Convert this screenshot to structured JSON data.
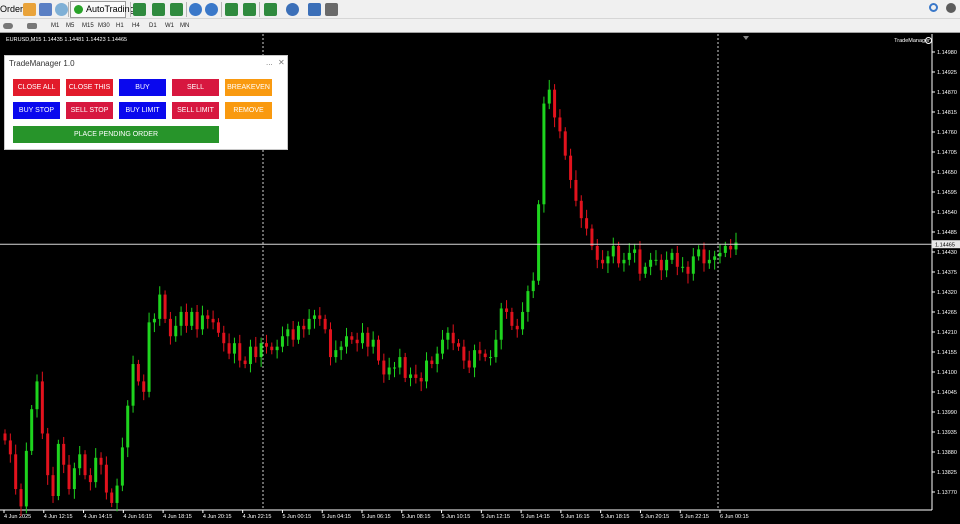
{
  "toolbar": {
    "order_label": "Order",
    "autotrading_label": "AutoTrading",
    "timeframes": [
      "M1",
      "M5",
      "M15",
      "M30",
      "H1",
      "H4",
      "D1",
      "W1",
      "MN"
    ]
  },
  "chart": {
    "symbol_info": "EURUSD,M15  1.14435 1.14481 1.14423 1.14465",
    "ea_name": "TradeManager",
    "current_price": "1.14465",
    "price_ticks": [
      "1.14980",
      "1.14925",
      "1.14870",
      "1.14815",
      "1.14760",
      "1.14705",
      "1.14650",
      "1.14595",
      "1.14540",
      "1.14485",
      "1.14430",
      "1.14375",
      "1.14320",
      "1.14265",
      "1.14210",
      "1.14155",
      "1.14100",
      "1.14045",
      "1.13990",
      "1.13935",
      "1.13880",
      "1.13825",
      "1.13770"
    ],
    "time_ticks": [
      "4 Jun 2025",
      "4 Jun 12:15",
      "4 Jun 14:15",
      "4 Jun 16:15",
      "4 Jun 18:15",
      "4 Jun 20:15",
      "4 Jun 22:15",
      "5 Jun 00:15",
      "5 Jun 04:15",
      "5 Jun 06:15",
      "5 Jun 08:15",
      "5 Jun 10:15",
      "5 Jun 12:15",
      "5 Jun 14:15",
      "5 Jun 16:15",
      "5 Jun 18:15",
      "5 Jun 20:15",
      "5 Jun 22:15",
      "6 Jun 00:15"
    ],
    "colors": {
      "bull": "#1ed41e",
      "bear": "#e2121d",
      "axis": "#ffffff"
    }
  },
  "chart_data": {
    "type": "candlestick",
    "symbol": "EURUSD",
    "timeframe": "M15",
    "ylim": [
      1.1374,
      1.1503
    ],
    "closes": [
      1.139,
      1.1386,
      1.1376,
      1.1371,
      1.1387,
      1.1399,
      1.1407,
      1.1392,
      1.138,
      1.1374,
      1.1389,
      1.1383,
      1.1376,
      1.1382,
      1.1386,
      1.138,
      1.1378,
      1.1385,
      1.1383,
      1.1375,
      1.1372,
      1.1377,
      1.1388,
      1.14,
      1.1412,
      1.1407,
      1.1404,
      1.1424,
      1.1425,
      1.1432,
      1.1425,
      1.142,
      1.1423,
      1.1427,
      1.1423,
      1.1427,
      1.1422,
      1.1426,
      1.1425,
      1.1424,
      1.1421,
      1.1418,
      1.1415,
      1.1418,
      1.1413,
      1.1412,
      1.1417,
      1.1414,
      1.1418,
      1.1417,
      1.1416,
      1.1417,
      1.142,
      1.1422,
      1.1419,
      1.1423,
      1.1422,
      1.1425,
      1.1426,
      1.1425,
      1.1422,
      1.1414,
      1.1416,
      1.1417,
      1.142,
      1.1419,
      1.1418,
      1.1421,
      1.1417,
      1.1419,
      1.1413,
      1.1409,
      1.1411,
      1.1411,
      1.1414,
      1.1408,
      1.1409,
      1.1408,
      1.1407,
      1.1413,
      1.1412,
      1.1415,
      1.1419,
      1.1421,
      1.1418,
      1.1417,
      1.1413,
      1.1411,
      1.1416,
      1.1415,
      1.1414,
      1.1414,
      1.1419,
      1.1428,
      1.1427,
      1.1423,
      1.1422,
      1.1427,
      1.1433,
      1.1436,
      1.1458,
      1.1487,
      1.1491,
      1.1483,
      1.1479,
      1.1472,
      1.1465,
      1.1459,
      1.1454,
      1.1451,
      1.1446,
      1.1442,
      1.1441,
      1.1443,
      1.1446,
      1.1441,
      1.1442,
      1.1444,
      1.1445,
      1.1438,
      1.144,
      1.1442,
      1.1442,
      1.1439,
      1.1442,
      1.1444,
      1.144,
      1.144,
      1.1438,
      1.1443,
      1.1445,
      1.1441,
      1.1442,
      1.1443,
      1.1444,
      1.1446,
      1.1445,
      1.1447
    ]
  },
  "panel": {
    "title": "TradeManager 1.0",
    "minimize": "...",
    "close": "✕",
    "buttons": [
      {
        "label": "CLOSE ALL",
        "name": "close-all-button"
      },
      {
        "label": "CLOSE THIS",
        "name": "close-this-button"
      },
      {
        "label": "BUY",
        "name": "buy-button"
      },
      {
        "label": "SELL",
        "name": "sell-button"
      },
      {
        "label": "BREAKEVEN",
        "name": "breakeven-button"
      },
      {
        "label": "BUY STOP",
        "name": "buy-stop-button"
      },
      {
        "label": "SELL STOP",
        "name": "sell-stop-button"
      },
      {
        "label": "BUY LIMIT",
        "name": "buy-limit-button"
      },
      {
        "label": "SELL LIMIT",
        "name": "sell-limit-button"
      },
      {
        "label": "REMOVE",
        "name": "remove-button"
      },
      {
        "label": "PLACE PENDING ORDER",
        "name": "place-pending-order-button"
      }
    ]
  }
}
